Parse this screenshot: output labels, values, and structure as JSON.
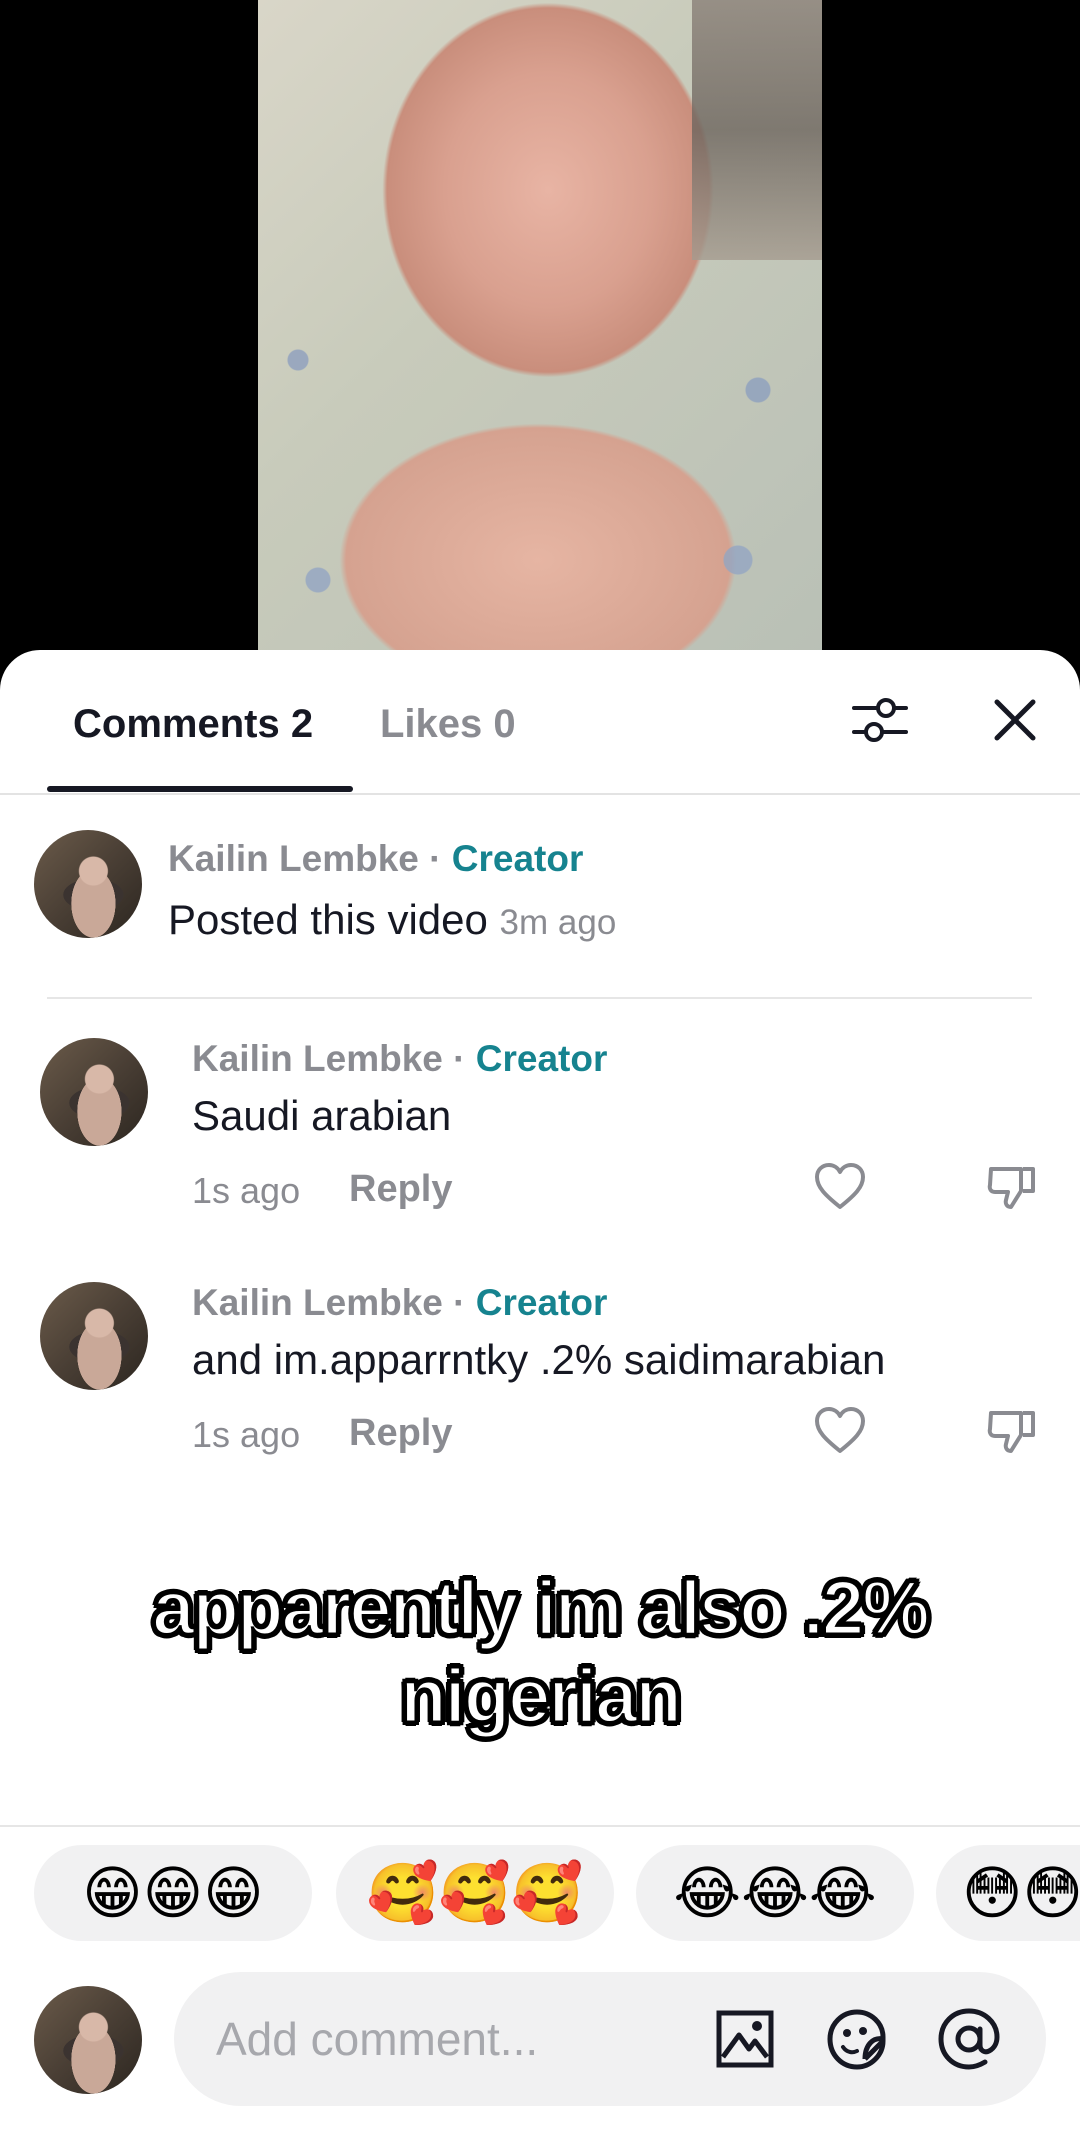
{
  "tabs": {
    "comments": "Comments 2",
    "likes": "Likes 0"
  },
  "icons": {
    "filter": "filter-sliders-icon",
    "close": "close-icon",
    "like": "heart-icon",
    "dislike": "thumbs-down-icon",
    "image": "image-icon",
    "sticker": "sticker-icon",
    "mention": "at-icon"
  },
  "post": {
    "name": "Kailin Lembke",
    "sep": " · ",
    "badge": "Creator",
    "text": "Posted this video",
    "time": "3m ago"
  },
  "comments": [
    {
      "name": "Kailin Lembke",
      "sep": " · ",
      "badge": "Creator",
      "text": "Saudi arabian",
      "time": "1s ago",
      "reply": "Reply"
    },
    {
      "name": "Kailin Lembke",
      "sep": " · ",
      "badge": "Creator",
      "text": "and im.apparrntky .2% saidimarabian",
      "time": "1s ago",
      "reply": "Reply"
    }
  ],
  "caption": {
    "line1": "apparently im also .2%",
    "line2": "nigerian"
  },
  "emoji_bar": [
    "😁😁😁",
    "🥰🥰🥰",
    "😂😂😂",
    "😳😳"
  ],
  "input": {
    "placeholder": "Add comment..."
  },
  "colors": {
    "creator": "#16838f",
    "text": "#161823",
    "muted": "#8a8b91"
  }
}
